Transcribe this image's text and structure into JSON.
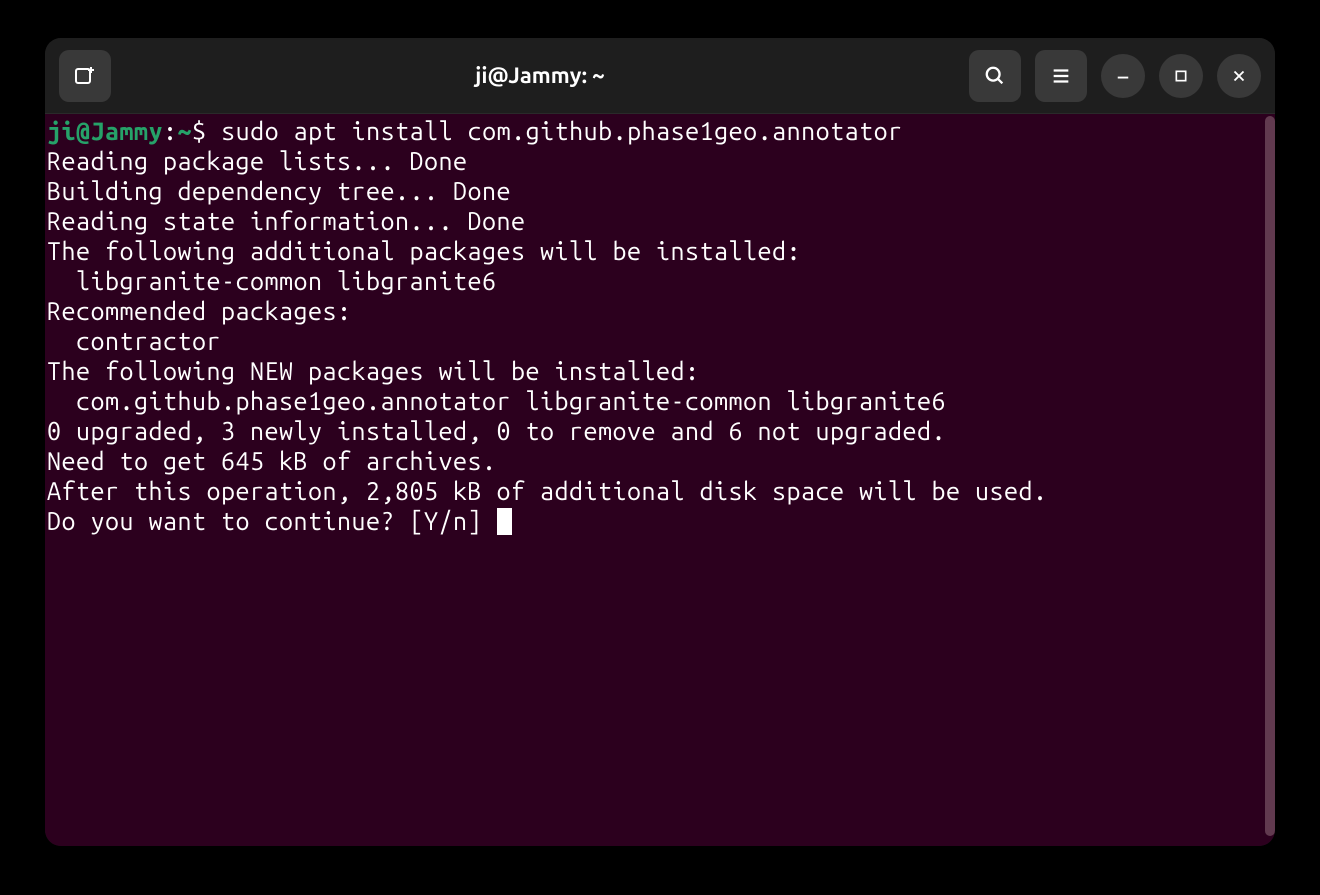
{
  "window": {
    "title": "ji@Jammy: ~"
  },
  "prompt": {
    "user_host": "ji@Jammy",
    "colon": ":",
    "path": "~",
    "dollar": "$ ",
    "command": "sudo apt install com.github.phase1geo.annotator"
  },
  "output": {
    "line1": "Reading package lists... Done",
    "line2": "Building dependency tree... Done",
    "line3": "Reading state information... Done",
    "line4": "The following additional packages will be installed:",
    "line5": "  libgranite-common libgranite6",
    "line6": "Recommended packages:",
    "line7": "  contractor",
    "line8": "The following NEW packages will be installed:",
    "line9": "  com.github.phase1geo.annotator libgranite-common libgranite6",
    "line10": "0 upgraded, 3 newly installed, 0 to remove and 6 not upgraded.",
    "line11": "Need to get 645 kB of archives.",
    "line12": "After this operation, 2,805 kB of additional disk space will be used.",
    "line13": "Do you want to continue? [Y/n] "
  }
}
